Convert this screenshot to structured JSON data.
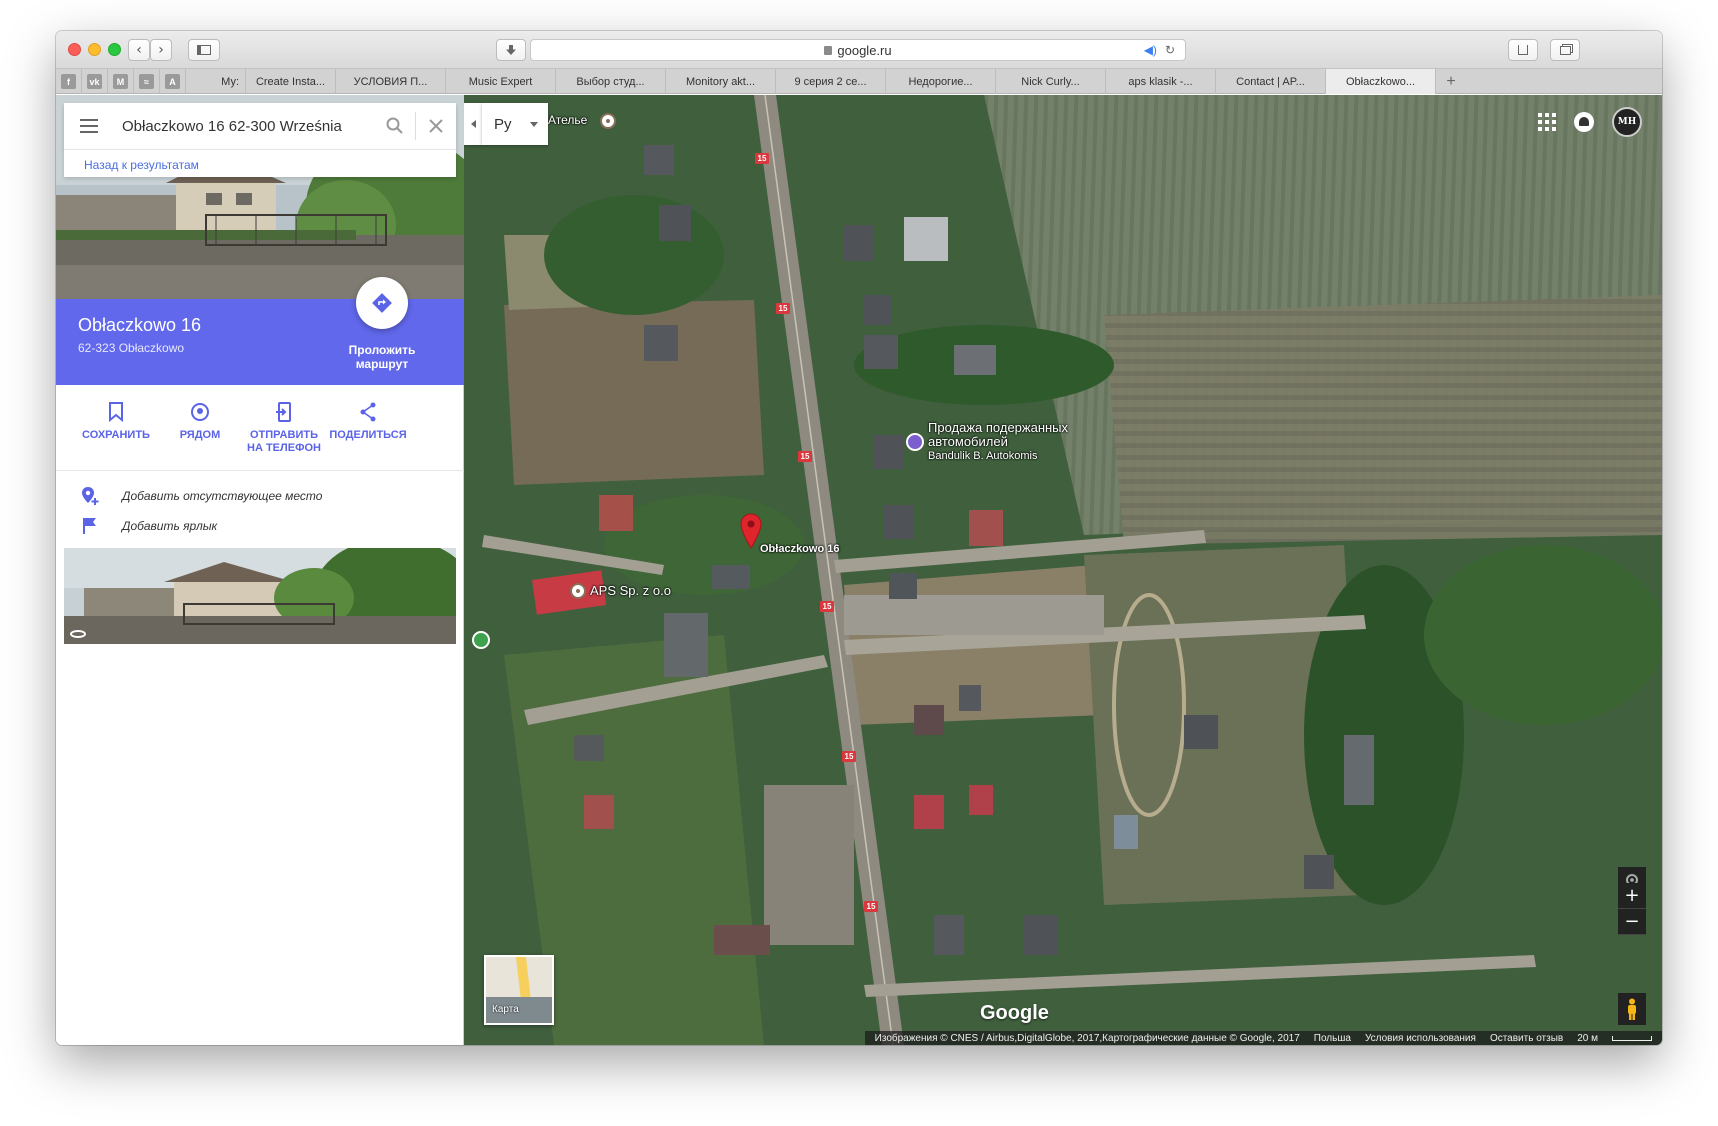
{
  "browser": {
    "url": "google.ru",
    "tabs": [
      "Му:",
      "Create Insta...",
      "УСЛОВИЯ П...",
      "Music Expert",
      "Выбор студ...",
      "Monitory akt...",
      "9 серия 2 се...",
      "Недорогие...",
      "Nick Curly...",
      "aps klasik -...",
      "Contact | AP...",
      "Obłaczkowo..."
    ],
    "pinned_favicons": [
      "facebook-icon",
      "vk-icon",
      "m-icon",
      "soundcloud-icon",
      "a-icon"
    ],
    "pinned_letters": [
      "f",
      "vk",
      "M",
      "≈",
      "A"
    ]
  },
  "search": {
    "value": "Obłaczkowo 16 62-300 Września",
    "back_link": "Назад к результатам"
  },
  "place": {
    "title": "Obłaczkowo 16",
    "subtitle": "62-323 Obłaczkowo",
    "route_label": "Проложить маршрут"
  },
  "actions": [
    {
      "label": "СОХРАНИТЬ",
      "icon": "bookmark-icon"
    },
    {
      "label": "РЯДОМ",
      "icon": "nearby-icon"
    },
    {
      "label": "ОТПРАВИТЬ НА ТЕЛЕФОН",
      "icon": "send-to-phone-icon"
    },
    {
      "label": "ПОДЕЛИТЬСЯ",
      "icon": "share-icon"
    }
  ],
  "extras": [
    {
      "label": "Добавить отсутствующее место",
      "icon": "add-place-icon"
    },
    {
      "label": "Добавить ярлык",
      "icon": "flag-icon"
    }
  ],
  "map": {
    "language_selector": "Ру",
    "labels": {
      "atelier": "Ателье",
      "car_dealer_line1": "Продажа подержанных",
      "car_dealer_line2": "автомобилей",
      "car_dealer_name": "Bandulik B. Autokomis",
      "pin": "Obłaczkowo 16",
      "aps": "APS Sp. z o.o",
      "road_number": "15"
    },
    "minimap_label": "Карта",
    "logo": "Google",
    "attribution": "Изображения © CNES / Airbus,DigitalGlobe, 2017,Картографические данные © Google, 2017",
    "country": "Польша",
    "terms": "Условия использования",
    "feedback": "Оставить отзыв",
    "scale": "20 м",
    "avatar_text": "MH",
    "colors": {
      "accent": "#6168eb",
      "pin": "#e0242b",
      "road_shield": "#d9383e"
    }
  }
}
